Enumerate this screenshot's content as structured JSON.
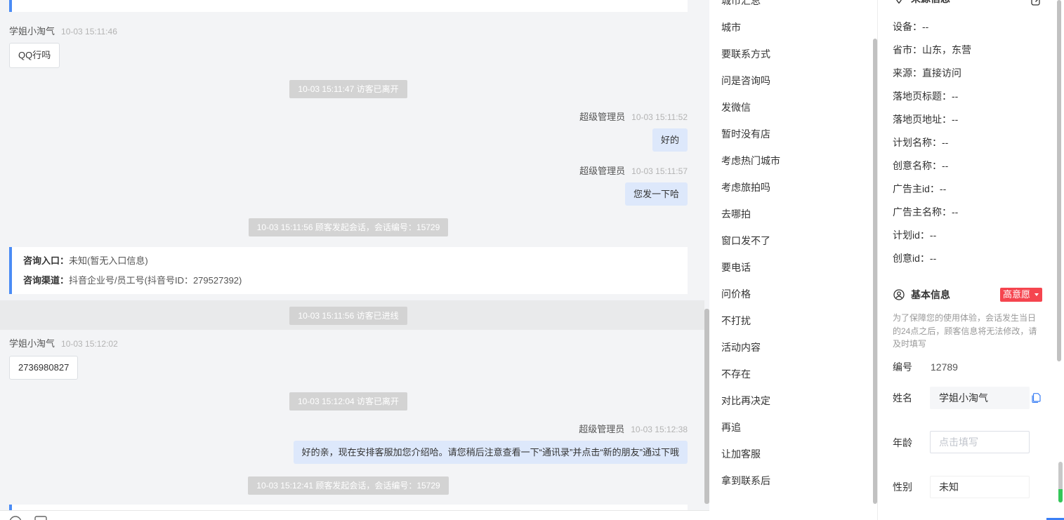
{
  "chat": {
    "messages": [
      {
        "sender": "学姐小淘气",
        "time": "10-03 15:11:46",
        "text": "QQ行吗"
      },
      {
        "text": "10-03 15:11:47 访客已离开"
      },
      {
        "sender": "超级管理员",
        "time": "10-03 15:11:52",
        "text": "好的"
      },
      {
        "sender": "超级管理员",
        "time": "10-03 15:11:57",
        "text": "您发一下哈"
      },
      {
        "text": "10-03 15:11:56 顾客发起会话，会话编号：15729"
      },
      {
        "entry_label": "咨询入口：",
        "entry_value": "未知(暂无入口信息)",
        "channel_label": "咨询渠道：",
        "channel_value": "抖音企业号/员工号(抖音号ID：279527392)"
      },
      {
        "text": "10-03 15:11:56 访客已进线"
      },
      {
        "sender": "学姐小淘气",
        "time": "10-03 15:12:02",
        "text": "2736980827"
      },
      {
        "text": "10-03 15:12:04 访客已离开"
      },
      {
        "sender": "超级管理员",
        "time": "10-03 15:12:38",
        "text": "好的亲，现在安排客服加您介绍哈。请您稍后注意查看一下“通讯录”并点击“新的朋友”通过下哦"
      },
      {
        "text": "10-03 15:12:41 顾客发起会话，会话编号：15729"
      }
    ]
  },
  "quick_replies": [
    "城市汇总",
    "城市",
    "要联系方式",
    "问是咨询吗",
    "发微信",
    "暂时没有店",
    "考虑热门城市",
    "考虑旅拍吗",
    "去哪拍",
    "窗口发不了",
    "要电话",
    "问价格",
    "不打扰",
    "活动内容",
    "不存在",
    "对比再决定",
    "再追",
    "让加客服",
    "拿到联系后"
  ],
  "source_info": {
    "title": "来源信息",
    "fields": [
      {
        "label": "设备：",
        "value": "--"
      },
      {
        "label": "省市：",
        "value": "山东，东营"
      },
      {
        "label": "来源：",
        "value": "直接访问"
      },
      {
        "label": "落地页标题：",
        "value": "--"
      },
      {
        "label": "落地页地址：",
        "value": "--"
      },
      {
        "label": "计划名称：",
        "value": "--"
      },
      {
        "label": "创意名称：",
        "value": "--"
      },
      {
        "label": "广告主id：",
        "value": "--"
      },
      {
        "label": "广告主名称：",
        "value": "--"
      },
      {
        "label": "计划id：",
        "value": "--"
      },
      {
        "label": "创意id：",
        "value": "--"
      }
    ]
  },
  "basic_info": {
    "title": "基本信息",
    "intent_badge": "高意愿",
    "note": "为了保障您的使用体验，会话发生当日的24点之后，顾客信息将无法修改，请及时填写",
    "id": {
      "label": "编号",
      "value": "12789"
    },
    "name": {
      "label": "姓名",
      "value": "学姐小淘气"
    },
    "age": {
      "label": "年龄",
      "placeholder": "点击填写"
    },
    "gender": {
      "label": "性别",
      "value": "未知"
    }
  },
  "icons": {
    "source_header": "location-pin-icon",
    "source_edit": "edit-icon",
    "basic_info_header": "user-circle-icon",
    "intent_dropdown": "caret-down-icon",
    "name_copy": "copy-icon",
    "toolbar": [
      "emoji-icon",
      "image-icon"
    ]
  },
  "colors": {
    "accent_blue": "#4b8cf5",
    "badge_red": "#f5454f",
    "agent_bubble": "#dde8fb",
    "system_notice": "#d3d3d3",
    "chat_background": "#f3f4f6",
    "link_blue": "#3b7ff5",
    "success_green": "#34c759"
  }
}
